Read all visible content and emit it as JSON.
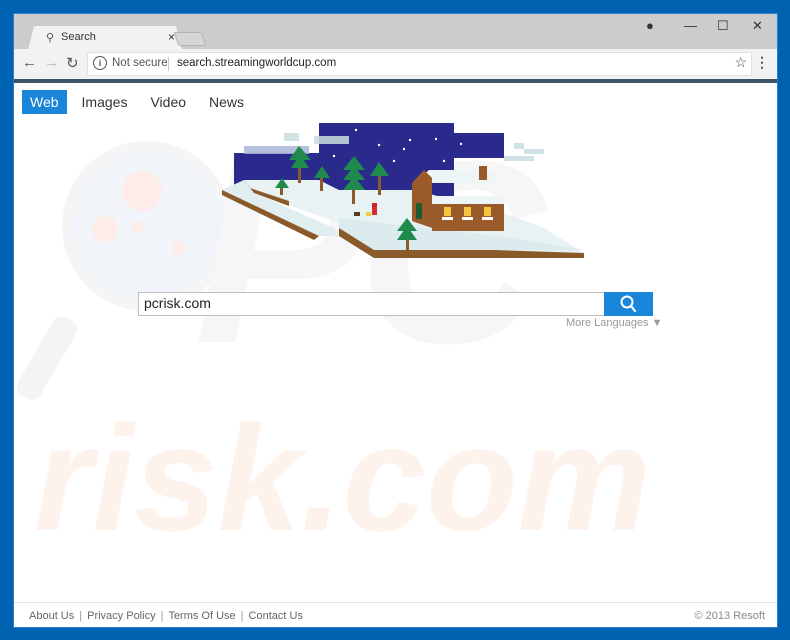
{
  "browser": {
    "tab_title": "Search",
    "tab_close": "×",
    "address": {
      "security_label": "Not secure",
      "url": "search.streamingworldcup.com"
    },
    "icons": {
      "back": "←",
      "forward": "→",
      "reload": "↻",
      "info": "i",
      "star": "☆",
      "menu": "⋮",
      "profile": "●",
      "minimize": "—",
      "maximize": "☐",
      "close": "✕",
      "tab_search": "⚲"
    }
  },
  "page": {
    "search_tabs": [
      {
        "label": "Web",
        "active": true
      },
      {
        "label": "Images",
        "active": false
      },
      {
        "label": "Video",
        "active": false
      },
      {
        "label": "News",
        "active": false
      }
    ],
    "search": {
      "value": "pcrisk.com",
      "placeholder": ""
    },
    "more_languages": "More Languages ▼",
    "footer": {
      "links": [
        "About Us",
        "Privacy Policy",
        "Terms Of Use",
        "Contact Us"
      ],
      "separator": "|",
      "copyright": "© 2013 Resoft"
    },
    "watermark": {
      "top": "PC",
      "bottom": "risk.com"
    }
  },
  "colors": {
    "desktop": "#0063b1",
    "accent": "#1a86d9",
    "sky": "#2a2a8c",
    "snow": "#e8f2f3",
    "tree": "#1f8a4c",
    "house": "#9a5a2a"
  }
}
